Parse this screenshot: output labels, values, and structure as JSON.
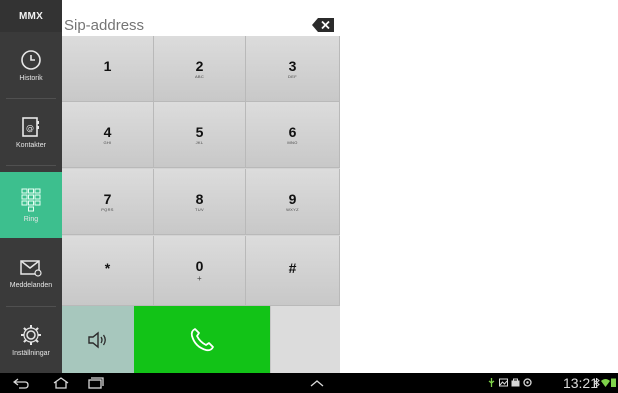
{
  "app": {
    "brand": "MMX"
  },
  "sidebar": {
    "items": [
      {
        "label": "Historik",
        "icon": "clock-icon",
        "active": false
      },
      {
        "label": "Kontakter",
        "icon": "contact-book-icon",
        "active": false
      },
      {
        "label": "Ring",
        "icon": "dialpad-icon",
        "active": true
      },
      {
        "label": "Meddelanden",
        "icon": "envelope-icon",
        "active": false
      },
      {
        "label": "Inställningar",
        "icon": "gear-icon",
        "active": false
      }
    ],
    "active_color": "#3dbf8e"
  },
  "sip": {
    "placeholder": "Sip-address",
    "value": ""
  },
  "keypad": {
    "keys": [
      {
        "digit": "1",
        "letters": ""
      },
      {
        "digit": "2",
        "letters": "ABC"
      },
      {
        "digit": "3",
        "letters": "DEF"
      },
      {
        "digit": "4",
        "letters": "GHI"
      },
      {
        "digit": "5",
        "letters": "JKL"
      },
      {
        "digit": "6",
        "letters": "MNO"
      },
      {
        "digit": "7",
        "letters": "PQRS"
      },
      {
        "digit": "8",
        "letters": "TUV"
      },
      {
        "digit": "9",
        "letters": "WXYZ"
      },
      {
        "digit": "*",
        "letters": ""
      },
      {
        "digit": "0",
        "letters": "+"
      },
      {
        "digit": "#",
        "letters": ""
      }
    ]
  },
  "actions": {
    "call_color": "#12c317",
    "speaker_color": "#a7c7bd"
  },
  "system_bar": {
    "time": "13:21"
  }
}
